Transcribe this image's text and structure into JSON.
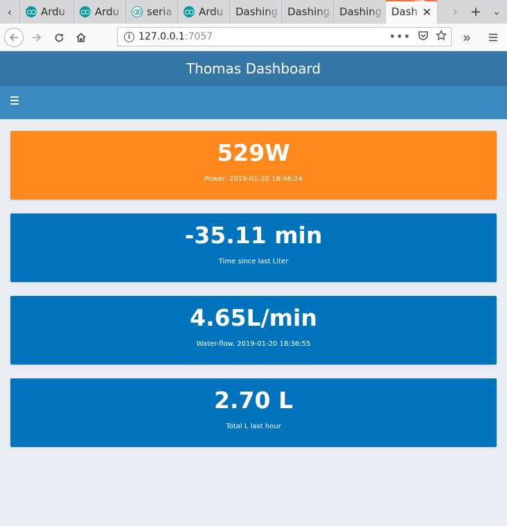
{
  "browser": {
    "tabs": [
      {
        "label": "Ardu",
        "icon": "arduino-icon",
        "active": false
      },
      {
        "label": "Ardu",
        "icon": "arduino-icon",
        "active": false
      },
      {
        "label": "seria",
        "icon": "arduino-icon",
        "active": false
      },
      {
        "label": "Ardu",
        "icon": "arduino-icon",
        "active": false
      },
      {
        "label": "Dashing",
        "active": false
      },
      {
        "label": "Dashing",
        "active": false
      },
      {
        "label": "Dashing",
        "active": false
      },
      {
        "label": "Dash",
        "active": true
      }
    ],
    "url": {
      "host": "127.0.0.1",
      "port": ":7057"
    }
  },
  "page": {
    "title": "Thomas Dashboard",
    "widgets": [
      {
        "value": "529W",
        "caption": "Power. 2019-01-20 18:46:24",
        "color": "#ff881c"
      },
      {
        "value": "-35.11 min",
        "caption": "Time since last Liter",
        "color": "#0073bd"
      },
      {
        "value": "4.65L/min",
        "caption": "Water-flow. 2019-01-20 18:36:55",
        "color": "#0073bd"
      },
      {
        "value": "2.70 L",
        "caption": "Total L last hour",
        "color": "#0073bd"
      }
    ]
  },
  "colors": {
    "header": "#3476a6",
    "menubar": "#3a8ac0",
    "background": "#e9ecf1"
  }
}
